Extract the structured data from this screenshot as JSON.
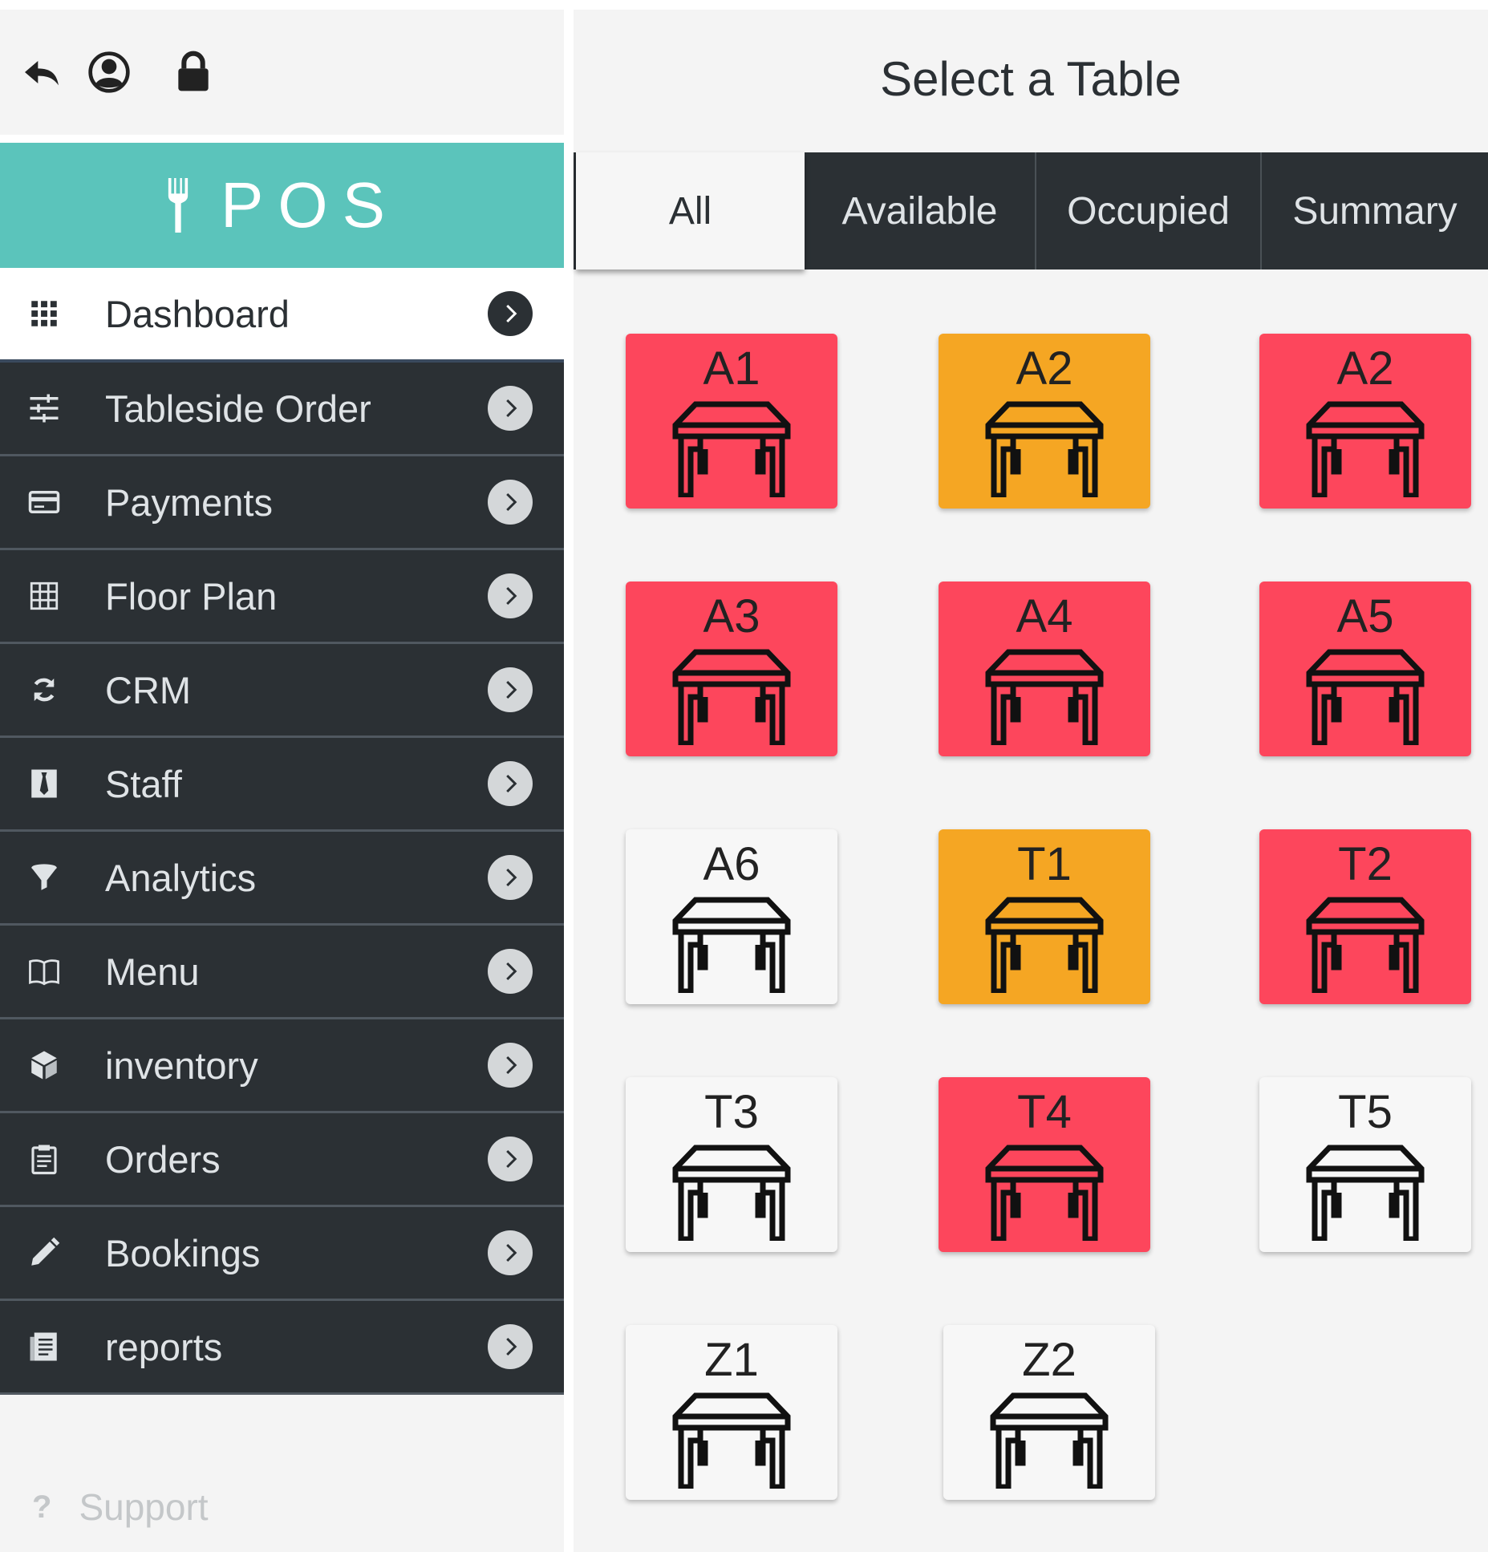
{
  "header": {
    "icons": [
      "back-icon",
      "user-icon",
      "lock-icon"
    ]
  },
  "brand": {
    "icon": "fork-icon",
    "label": "POS",
    "color": "#5bc4bb"
  },
  "sidebar": {
    "items": [
      {
        "label": "Dashboard",
        "icon": "grid-icon",
        "active": true
      },
      {
        "label": "Tableside Order",
        "icon": "sliders-icon"
      },
      {
        "label": "Payments",
        "icon": "credit-card-icon"
      },
      {
        "label": "Floor Plan",
        "icon": "floor-grid-icon"
      },
      {
        "label": "CRM",
        "icon": "refresh-icon"
      },
      {
        "label": "Staff",
        "icon": "tie-icon"
      },
      {
        "label": "Analytics",
        "icon": "funnel-icon"
      },
      {
        "label": "Menu",
        "icon": "book-icon"
      },
      {
        "label": "inventory",
        "icon": "box-icon"
      },
      {
        "label": "Orders",
        "icon": "clipboard-icon"
      },
      {
        "label": "Bookings",
        "icon": "pencil-icon"
      },
      {
        "label": "reports",
        "icon": "document-icon"
      }
    ],
    "support_label": "Support"
  },
  "main": {
    "title": "Select a Table",
    "tabs": [
      {
        "label": "All",
        "active": true
      },
      {
        "label": "Available"
      },
      {
        "label": "Occupied"
      },
      {
        "label": "Summary"
      }
    ]
  },
  "colors": {
    "occupied": "#fd465c",
    "reserved": "#f5a623",
    "available": "#f7f7f7",
    "dark": "#2b3034"
  },
  "tables": [
    {
      "name": "A1",
      "status": "occupied"
    },
    {
      "name": "A2",
      "status": "reserved"
    },
    {
      "name": "A2",
      "status": "occupied"
    },
    {
      "name": "A3",
      "status": "occupied"
    },
    {
      "name": "A4",
      "status": "occupied"
    },
    {
      "name": "A5",
      "status": "occupied"
    },
    {
      "name": "A6",
      "status": "available"
    },
    {
      "name": "T1",
      "status": "reserved"
    },
    {
      "name": "T2",
      "status": "occupied"
    },
    {
      "name": "T3",
      "status": "available"
    },
    {
      "name": "T4",
      "status": "occupied"
    },
    {
      "name": "T5",
      "status": "available"
    },
    {
      "name": "Z1",
      "status": "available"
    },
    {
      "name": "Z2",
      "status": "available"
    }
  ]
}
